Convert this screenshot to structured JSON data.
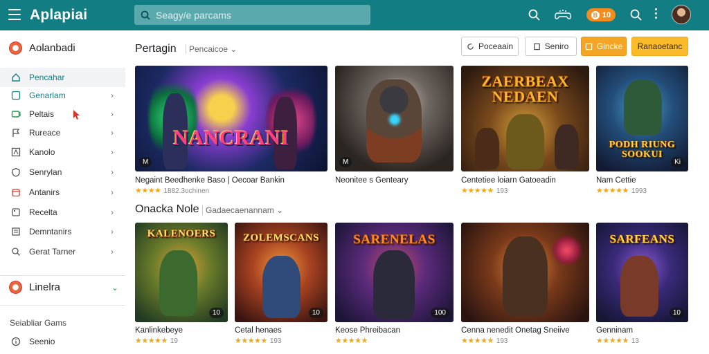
{
  "app": {
    "title": "Aplapiai"
  },
  "search": {
    "placeholder": "Seagy/e parcams"
  },
  "top_bar": {
    "coins_label": "10",
    "icons": [
      "search-icon",
      "gamepad-icon",
      "coin-icon",
      "search-icon",
      "more-vert-icon",
      "user-avatar"
    ]
  },
  "sidebar": {
    "header": "Aolanbadi",
    "items": [
      {
        "label": "Pencahar",
        "icon": "home-icon",
        "active": true
      },
      {
        "label": "Genarlam",
        "icon": "grid-icon",
        "chevron": "›"
      },
      {
        "label": "Peltais",
        "icon": "controller-icon",
        "chevron": "›"
      },
      {
        "label": "Rureace",
        "icon": "flag-icon",
        "chevron": "›"
      },
      {
        "label": "Kanolo",
        "icon": "puzzle-icon",
        "chevron": "›"
      },
      {
        "label": "Senrylan",
        "icon": "shield-icon",
        "chevron": "›"
      },
      {
        "label": "Antanirs",
        "icon": "calendar-icon",
        "chevron": "›"
      },
      {
        "label": "Recelta",
        "icon": "tag-icon",
        "chevron": "›"
      },
      {
        "label": "Demntanirs",
        "icon": "bookmark-icon",
        "chevron": "›"
      },
      {
        "label": "Gerat Tarner",
        "icon": "search-icon",
        "chevron": "›"
      }
    ],
    "section2": {
      "label": "Linelra",
      "chevron": "⌄"
    },
    "footer_heading": "Seiabliar Gams",
    "footer_item": "Seenio"
  },
  "section1": {
    "title": "Pertagin",
    "subtitle": "Pencaicoe",
    "buttons": [
      "Poceaain",
      "Seniro",
      "Gincke",
      "Ranaoetanc"
    ],
    "cards": [
      {
        "title": "Negaint Beedhenke Baso | Oecoar Bankin",
        "rating_text": "1882.3ochinen",
        "stars": "★★★★",
        "badge": "M",
        "art_title": "NANCRANI"
      },
      {
        "title": "Neonitee s Genteary",
        "rating_text": "",
        "stars": "",
        "badge": "M",
        "art_title": ""
      },
      {
        "title": "Centetiee loiarn Gatoeadin",
        "rating_text": "193",
        "stars": "★★★★★",
        "badge": "",
        "art_title": "ZAERBEAX NEDAEN"
      },
      {
        "title": "Nam Cettie",
        "rating_text": "1993",
        "stars": "★★★★★",
        "badge": "Ki",
        "art_title": "PODH RIUNG SOOKUI"
      }
    ]
  },
  "section2_main": {
    "title": "Onacka Nole",
    "subtitle": "Gadaecaenannam",
    "cards": [
      {
        "title": "Kanlinkebeye",
        "rating_text": "19",
        "stars": "★★★★★",
        "badge": "10",
        "art_title": "KALENOERS"
      },
      {
        "title": "Cetal henaes",
        "rating_text": "193",
        "stars": "★★★★★",
        "badge": "10",
        "art_title": "ZOLEMSCANS"
      },
      {
        "title": "Keose Phreibacan",
        "rating_text": "",
        "stars": "★★★★★",
        "badge": "100",
        "art_title": "SARENELAS"
      },
      {
        "title": "Cenna nenedit Onetag Sneiive",
        "rating_text": "193",
        "stars": "★★★★★",
        "badge": "",
        "art_title": ""
      },
      {
        "title": "Genninam",
        "rating_text": "13",
        "stars": "★★★★★",
        "badge": "10",
        "art_title": "SARFEANS"
      }
    ]
  },
  "colors": {
    "topbar": "#127d83",
    "accent": "#127d83",
    "orange": "#f4a524",
    "yellow": "#f9bb2a",
    "star": "#f2a51a"
  }
}
